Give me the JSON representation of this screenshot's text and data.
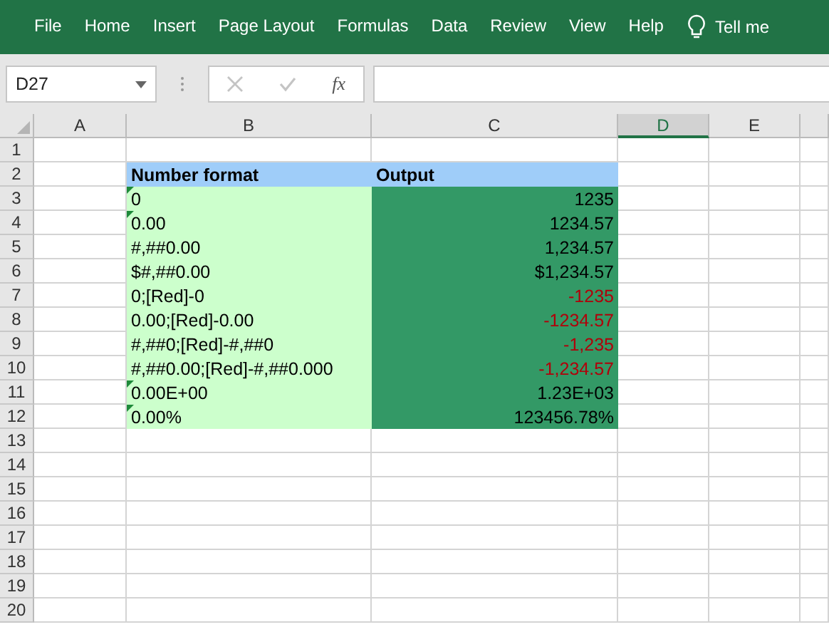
{
  "ribbon": {
    "tabs": [
      {
        "label": "File",
        "selected": false
      },
      {
        "label": "Home",
        "selected": false
      },
      {
        "label": "Insert",
        "selected": false
      },
      {
        "label": "Page Layout",
        "selected": false
      },
      {
        "label": "Formulas",
        "selected": false
      },
      {
        "label": "Data",
        "selected": false
      },
      {
        "label": "Review",
        "selected": false
      },
      {
        "label": "View",
        "selected": false
      },
      {
        "label": "Help",
        "selected": false
      }
    ],
    "tell_me": "Tell me"
  },
  "formula_bar": {
    "name_box": "D27",
    "function_label": "fx"
  },
  "columns": [
    {
      "label": "A",
      "selected": false
    },
    {
      "label": "B",
      "selected": false
    },
    {
      "label": "C",
      "selected": false
    },
    {
      "label": "D",
      "selected": true
    },
    {
      "label": "E",
      "selected": false
    }
  ],
  "row_numbers": [
    "1",
    "2",
    "3",
    "4",
    "5",
    "6",
    "7",
    "8",
    "9",
    "10",
    "11",
    "12",
    "13",
    "14",
    "15",
    "16",
    "17",
    "18",
    "19",
    "20"
  ],
  "table": {
    "header": {
      "format": "Number format",
      "output": "Output"
    },
    "rows": [
      {
        "format": "0",
        "output": "1235",
        "flagged": true,
        "color": "#000000"
      },
      {
        "format": "0.00",
        "output": "1234.57",
        "flagged": true,
        "color": "#000000"
      },
      {
        "format": "#,##0.00",
        "output": "1,234.57",
        "flagged": false,
        "color": "#000000"
      },
      {
        "format": "$#,##0.00",
        "output": "$1,234.57",
        "flagged": false,
        "color": "#000000"
      },
      {
        "format": "0;[Red]-0",
        "output": "-1235",
        "flagged": false,
        "color": "#b0000a"
      },
      {
        "format": "0.00;[Red]-0.00",
        "output": "-1234.57",
        "flagged": false,
        "color": "#b0000a"
      },
      {
        "format": "#,##0;[Red]-#,##0",
        "output": "-1,235",
        "flagged": false,
        "color": "#b0000a"
      },
      {
        "format": "#,##0.00;[Red]-#,##0.000",
        "output": "-1,234.57",
        "flagged": false,
        "color": "#b0000a"
      },
      {
        "format": "0.00E+00",
        "output": "1.23E+03",
        "flagged": true,
        "color": "#000000"
      },
      {
        "format": "0.00%",
        "output": "123456.78%",
        "flagged": true,
        "color": "#000000"
      }
    ]
  }
}
